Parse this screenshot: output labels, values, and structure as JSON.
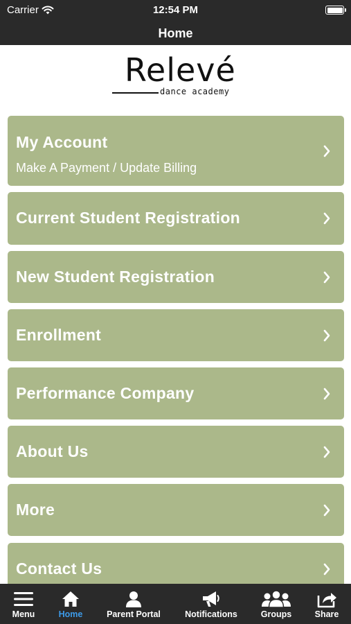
{
  "status_bar": {
    "carrier": "Carrier",
    "time": "12:54 PM"
  },
  "nav": {
    "title": "Home"
  },
  "logo": {
    "word": "Relevé",
    "sub": "dance academy"
  },
  "menu_items": [
    {
      "title": "My Account",
      "subtitle": "Make A Payment / Update Billing"
    },
    {
      "title": "Current Student Registration"
    },
    {
      "title": "New Student Registration"
    },
    {
      "title": "Enrollment"
    },
    {
      "title": "Performance Company"
    },
    {
      "title": "About Us"
    },
    {
      "title": "More"
    },
    {
      "title": "Contact Us"
    }
  ],
  "tabs": [
    {
      "label": "Menu",
      "icon": "hamburger-icon"
    },
    {
      "label": "Home",
      "icon": "home-icon",
      "active": true
    },
    {
      "label": "Parent Portal",
      "icon": "person-icon"
    },
    {
      "label": "Notifications",
      "icon": "megaphone-icon"
    },
    {
      "label": "Groups",
      "icon": "group-icon"
    },
    {
      "label": "Share",
      "icon": "share-icon"
    }
  ],
  "colors": {
    "bar_background": "#2a2a2a",
    "menu_item_background": "#abb88a",
    "active_tab": "#3d9be9"
  }
}
